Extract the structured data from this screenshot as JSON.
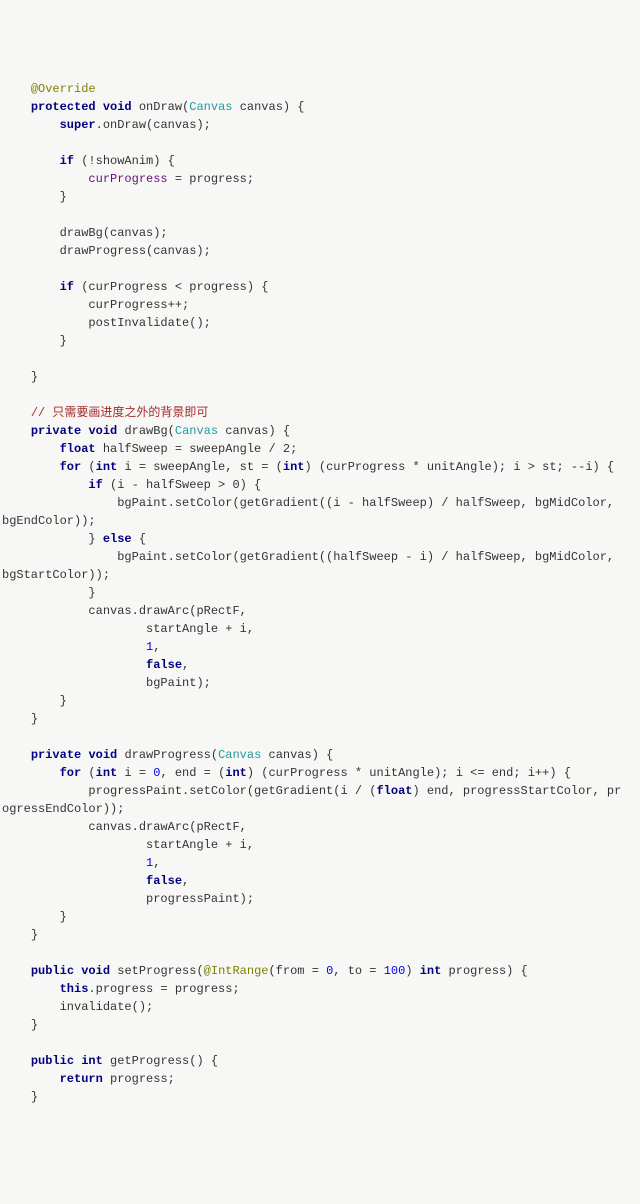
{
  "code": {
    "l1_indent": "    ",
    "l2_indent": "        ",
    "l3_indent": "            ",
    "l4_indent": "                ",
    "l5_indent": "                    ",
    "override": "@Override",
    "protected": "protected",
    "void": "void",
    "onDraw": "onDraw",
    "Canvas": "Canvas",
    "canvas_param": "canvas",
    "lbrace": " {",
    "rbrace": "}",
    "super": "super",
    "dot": ".",
    "onDraw_call": "onDraw(canvas);",
    "if": "if",
    "not_showAnim": "(!showAnim) {",
    "curProgress": "curProgress",
    "eq": " = ",
    "progress_semi": "progress;",
    "drawBg_call": "drawBg(canvas);",
    "drawProgress_call": "drawProgress(canvas);",
    "lt_progress": "(curProgress < progress) {",
    "curProgress_inc": "curProgress++;",
    "postInvalidate": "postInvalidate();",
    "comment_cn": "// 只需要画进度之外的背景即可",
    "private": "private",
    "drawBg": "drawBg",
    "float": "float",
    "halfSweep": "halfSweep",
    "sweepAngle_div2": "sweepAngle / 2;",
    "for": "for",
    "int": "int",
    "i_eq_sweep": " i = sweepAngle, st = (",
    "cast_int": "int",
    "curProg_unit": ") (curProgress * unitAngle); i > st; --i) {",
    "i_minus_half_gt0": "(i - halfSweep > 0) {",
    "bgPaint_setColor": "bgPaint.setColor(getGradient((i - halfSweep) / halfSweep, bgMidColor, ",
    "bgEndColor_close": "bgEndColor));",
    "else": "else",
    "bgPaint_setColor2": "bgPaint.setColor(getGradient((halfSweep - i) / halfSweep, bgMidColor, ",
    "bgStartColor_close": "bgStartColor));",
    "canvas_drawArc": "canvas.drawArc(pRectF,",
    "startAngle_plus_i": "startAngle + i,",
    "one": "1",
    "comma": ",",
    "false": "false",
    "bgPaint_close": "bgPaint);",
    "drawProgress": "drawProgress",
    "i_eq_0": " i = ",
    "zero": "0",
    "end_eq": ", end = (",
    "curProg_unit2": ") (curProgress * unitAngle); i <= end; i++) {",
    "progressPaint_setColor": "progressPaint.setColor(getGradient(i / (",
    "float_cast": "float",
    "end_progStart": ") end, progressStartColor, pr",
    "ogressEndColor_close": "ogressEndColor));",
    "progressPaint_close": "progressPaint);",
    "public": "public",
    "setProgress": "setProgress",
    "IntRange": "@IntRange",
    "from_eq": "(from = ",
    "to_eq": ", to = ",
    "hundred": "100",
    "close_int_progress": ") ",
    "int_progress": " progress) {",
    "this": "this",
    "dot_progress_eq": ".progress = progress;",
    "invalidate": "invalidate();",
    "getProgress": "getProgress",
    "empty_parens": "() {",
    "return": "return",
    "sp_progress_semi": " progress;"
  }
}
